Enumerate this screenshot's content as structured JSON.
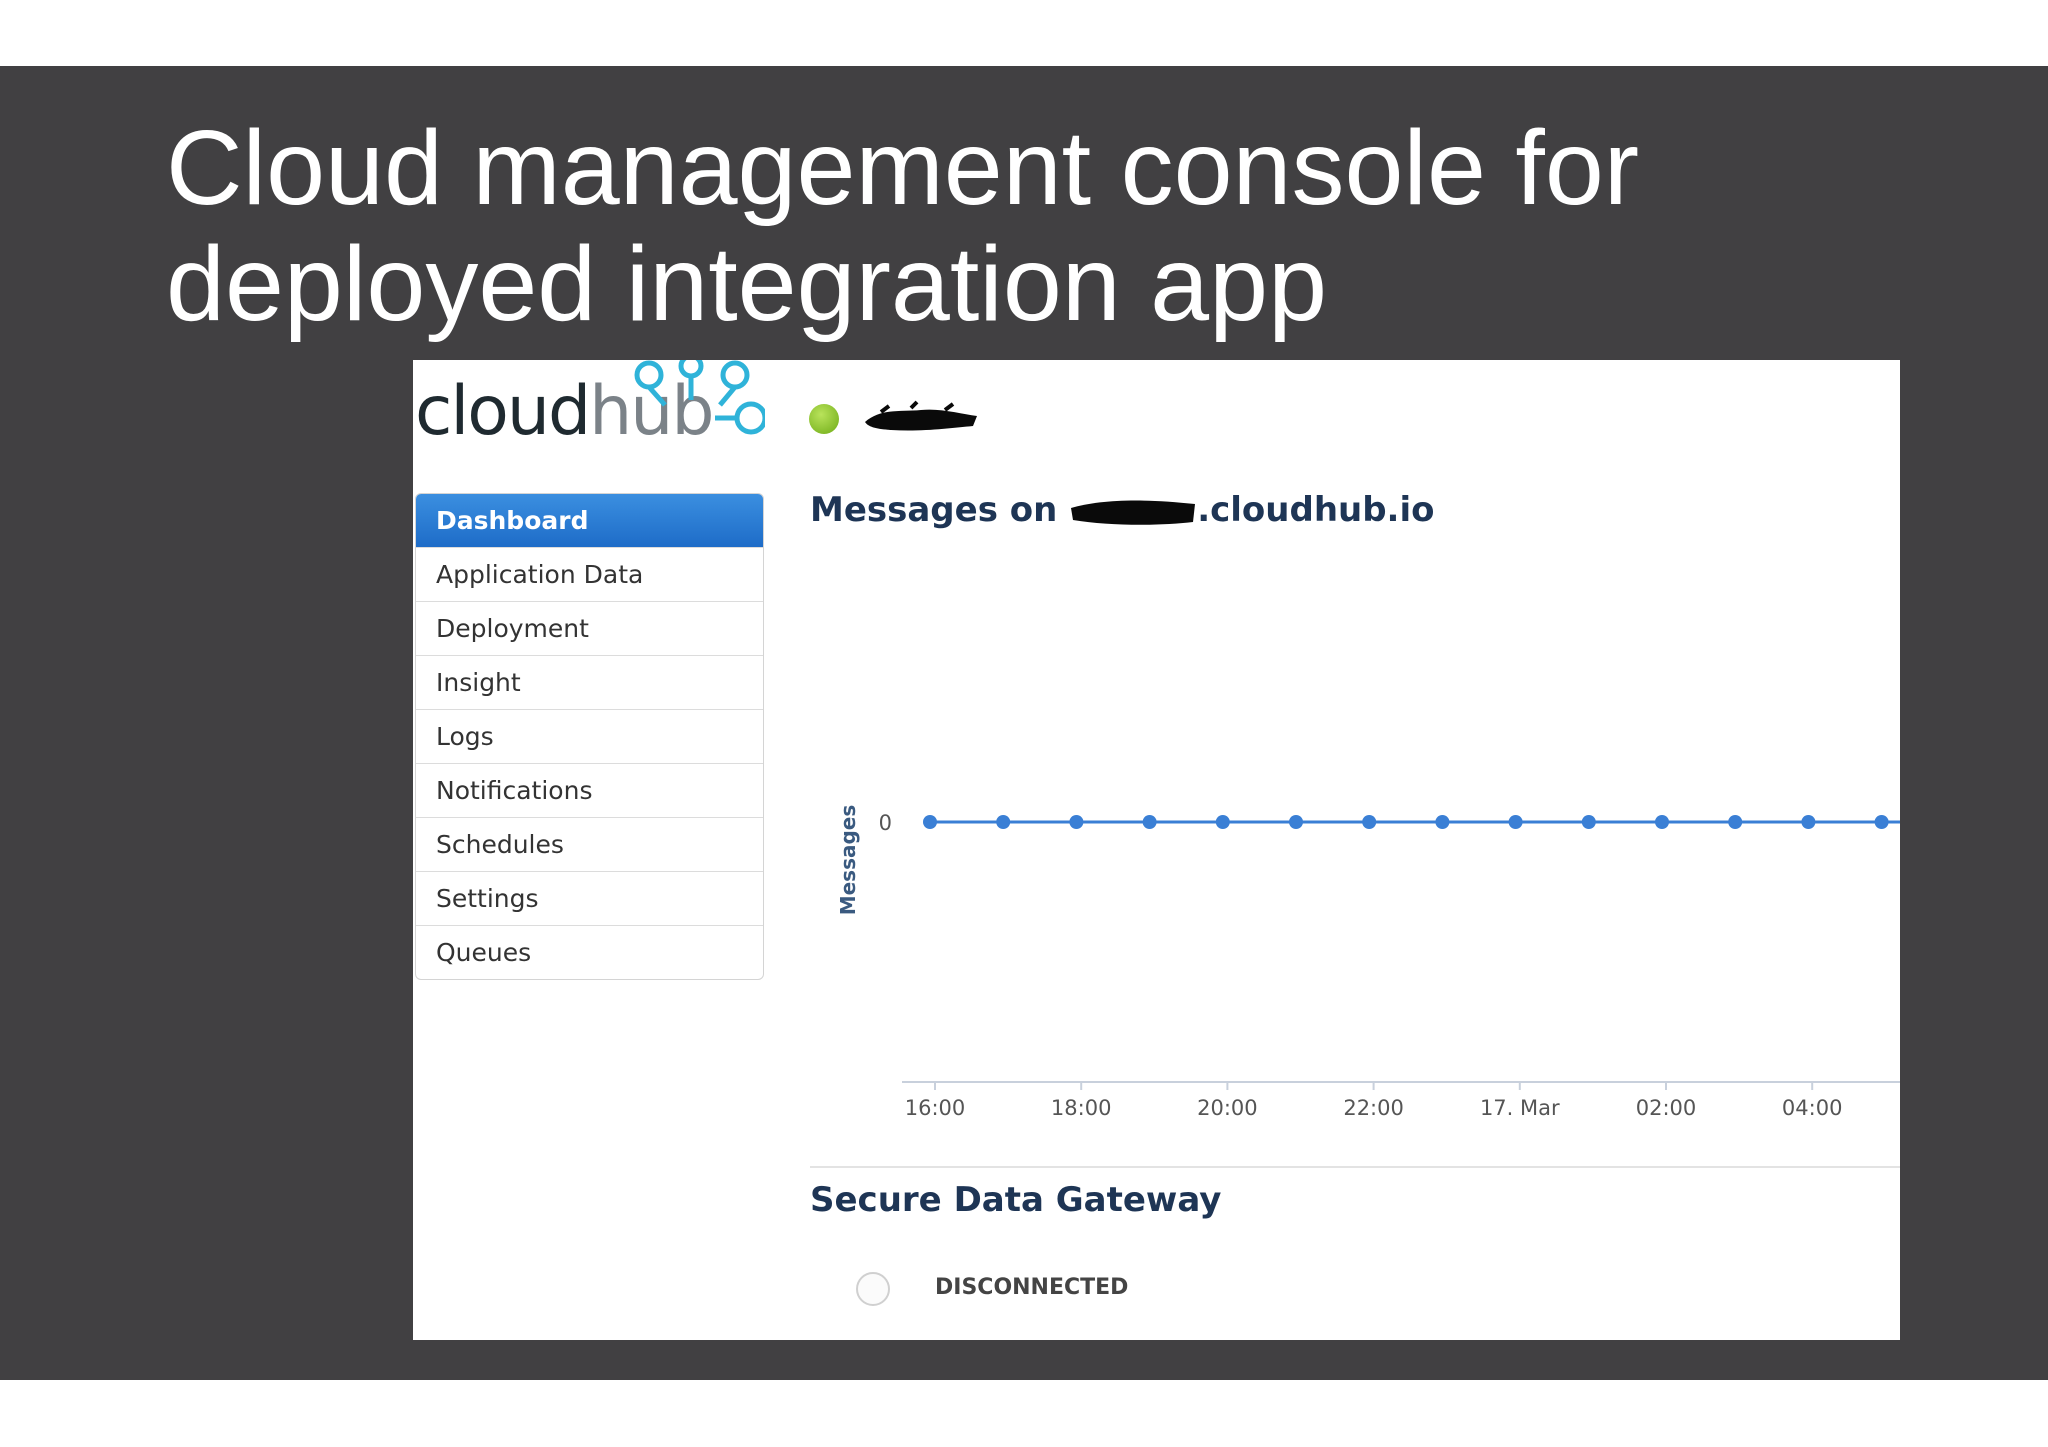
{
  "slide": {
    "title": "Cloud management console for\ndeployed integration app"
  },
  "logo": {
    "part1": "cloud",
    "part2": "hub"
  },
  "app": {
    "status": "running"
  },
  "sidebar": {
    "items": [
      {
        "label": "Dashboard",
        "active": true
      },
      {
        "label": "Application Data"
      },
      {
        "label": "Deployment"
      },
      {
        "label": "Insight"
      },
      {
        "label": "Logs"
      },
      {
        "label": "Notifications"
      },
      {
        "label": "Schedules"
      },
      {
        "label": "Settings"
      },
      {
        "label": "Queues"
      }
    ]
  },
  "messages": {
    "title_prefix": "Messages on ",
    "title_suffix": ".cloudhub.io"
  },
  "chart_data": {
    "type": "line",
    "ylabel": "Messages",
    "yticks": [
      "0"
    ],
    "xticks": [
      "16:00",
      "18:00",
      "20:00",
      "22:00",
      "17. Mar",
      "02:00",
      "04:00"
    ],
    "series": [
      {
        "values": [
          0,
          0,
          0,
          0,
          0,
          0,
          0,
          0,
          0,
          0,
          0,
          0,
          0,
          0
        ]
      }
    ],
    "color": "#3a7fd5"
  },
  "gateway": {
    "title": "Secure Data Gateway",
    "status": "DISCONNECTED"
  }
}
